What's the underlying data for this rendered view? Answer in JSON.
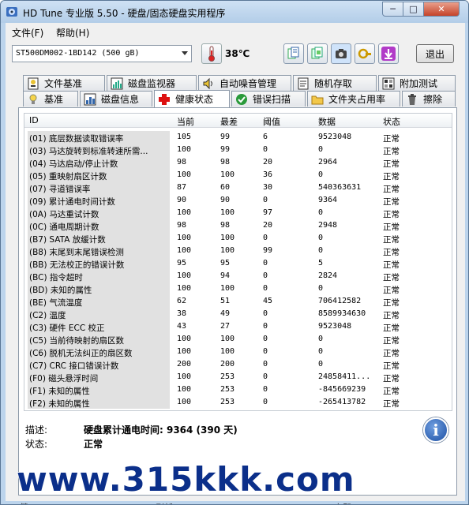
{
  "window": {
    "title": "HD Tune 专业版 5.50 - 硬盘/固态硬盘实用程序",
    "minimize_symbol": "─",
    "maximize_symbol": "□",
    "close_symbol": "✕"
  },
  "menu": [
    "文件(F)",
    "帮助(H)"
  ],
  "toolbar": {
    "drive": "ST500DM002-1BD142 (500 gB)",
    "temperature": "38℃",
    "exit_label": "退出",
    "buttons": [
      "copy-text-icon",
      "copy-screenshot-icon",
      "camera-icon",
      "options-icon",
      "save-download-icon"
    ]
  },
  "tabs_row1": [
    {
      "label": "文件基准",
      "icon": "file-benchmark-icon"
    },
    {
      "label": "磁盘监视器",
      "icon": "disk-monitor-icon"
    },
    {
      "label": "自动噪音管理",
      "icon": "speaker-icon"
    },
    {
      "label": "随机存取",
      "icon": "random-access-icon"
    },
    {
      "label": "附加测试",
      "icon": "extra-tests-icon"
    }
  ],
  "tabs_row2": [
    {
      "label": "基准",
      "icon": "benchmark-icon"
    },
    {
      "label": "磁盘信息",
      "icon": "disk-info-icon"
    },
    {
      "label": "健康状态",
      "icon": "health-cross-icon",
      "active": true
    },
    {
      "label": "错误扫描",
      "icon": "error-scan-icon"
    },
    {
      "label": "文件夹占用率",
      "icon": "folder-usage-icon"
    },
    {
      "label": "擦除",
      "icon": "erase-icon"
    }
  ],
  "grid": {
    "headers": [
      "ID",
      "当前",
      "最差",
      "阈值",
      "数据",
      "状态"
    ],
    "rows": [
      {
        "id": "(01) 底层数据读取错误率",
        "current": "105",
        "worst": "99",
        "threshold": "6",
        "data": "9523048",
        "status": "正常"
      },
      {
        "id": "(03) 马达旋转到标准转速所需...",
        "current": "100",
        "worst": "99",
        "threshold": "0",
        "data": "0",
        "status": "正常"
      },
      {
        "id": "(04) 马达启动/停止计数",
        "current": "98",
        "worst": "98",
        "threshold": "20",
        "data": "2964",
        "status": "正常"
      },
      {
        "id": "(05) 重映射扇区计数",
        "current": "100",
        "worst": "100",
        "threshold": "36",
        "data": "0",
        "status": "正常"
      },
      {
        "id": "(07) 寻道错误率",
        "current": "87",
        "worst": "60",
        "threshold": "30",
        "data": "540363631",
        "status": "正常"
      },
      {
        "id": "(09) 累计通电时间计数",
        "current": "90",
        "worst": "90",
        "threshold": "0",
        "data": "9364",
        "status": "正常"
      },
      {
        "id": "(0A) 马达重试计数",
        "current": "100",
        "worst": "100",
        "threshold": "97",
        "data": "0",
        "status": "正常"
      },
      {
        "id": "(0C) 通电周期计数",
        "current": "98",
        "worst": "98",
        "threshold": "20",
        "data": "2948",
        "status": "正常"
      },
      {
        "id": "(B7) SATA 放缓计数",
        "current": "100",
        "worst": "100",
        "threshold": "0",
        "data": "0",
        "status": "正常"
      },
      {
        "id": "(B8) 末尾到末尾错误检测",
        "current": "100",
        "worst": "100",
        "threshold": "99",
        "data": "0",
        "status": "正常"
      },
      {
        "id": "(BB) 无法校正的错误计数",
        "current": "95",
        "worst": "95",
        "threshold": "0",
        "data": "5",
        "status": "正常"
      },
      {
        "id": "(BC) 指令超时",
        "current": "100",
        "worst": "94",
        "threshold": "0",
        "data": "2824",
        "status": "正常"
      },
      {
        "id": "(BD) 未知的属性",
        "current": "100",
        "worst": "100",
        "threshold": "0",
        "data": "0",
        "status": "正常"
      },
      {
        "id": "(BE) 气流温度",
        "current": "62",
        "worst": "51",
        "threshold": "45",
        "data": "706412582",
        "status": "正常"
      },
      {
        "id": "(C2) 温度",
        "current": "38",
        "worst": "49",
        "threshold": "0",
        "data": "8589934630",
        "status": "正常"
      },
      {
        "id": "(C3) 硬件 ECC 校正",
        "current": "43",
        "worst": "27",
        "threshold": "0",
        "data": "9523048",
        "status": "正常"
      },
      {
        "id": "(C5) 当前待映射的扇区数",
        "current": "100",
        "worst": "100",
        "threshold": "0",
        "data": "0",
        "status": "正常"
      },
      {
        "id": "(C6) 脱机无法纠正的扇区数",
        "current": "100",
        "worst": "100",
        "threshold": "0",
        "data": "0",
        "status": "正常"
      },
      {
        "id": "(C7) CRC 接口错误计数",
        "current": "200",
        "worst": "200",
        "threshold": "0",
        "data": "0",
        "status": "正常"
      },
      {
        "id": "(F0) 磁头悬浮时间",
        "current": "100",
        "worst": "253",
        "threshold": "0",
        "data": "24858411...",
        "status": "正常"
      },
      {
        "id": "(F1) 未知的属性",
        "current": "100",
        "worst": "253",
        "threshold": "0",
        "data": "-845669239",
        "status": "正常"
      },
      {
        "id": "(F2) 未知的属性",
        "current": "100",
        "worst": "253",
        "threshold": "0",
        "data": "-265413782",
        "status": "正常"
      }
    ]
  },
  "description": {
    "desc_label": "描述:",
    "desc_value": "硬盘累计通电时间: 9364 (390 天)",
    "status_label": "状态:",
    "status_value": "正常",
    "info_symbol": "i"
  },
  "status_bar": {
    "left": "健",
    "middle": "刷新",
    "right": "立即"
  },
  "watermark": "www.315kkk.com"
}
